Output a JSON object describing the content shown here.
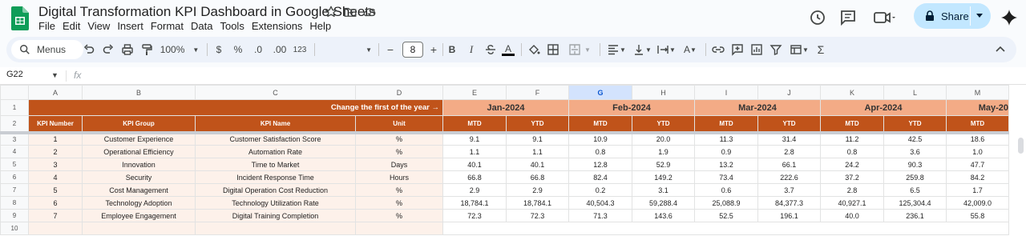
{
  "app": {
    "title": "Digital Transformation KPI Dashboard in Google Sheets",
    "menus": [
      "File",
      "Edit",
      "View",
      "Insert",
      "Format",
      "Data",
      "Tools",
      "Extensions",
      "Help"
    ],
    "share_label": "Share"
  },
  "toolbar": {
    "menus_label": "Menus",
    "zoom": "100%",
    "currency": "$",
    "percent": "%",
    "dec_decrease": ".0",
    "dec_increase": ".00",
    "format_123": "123",
    "font_size": "8",
    "bold": "B",
    "italic": "I"
  },
  "formula_bar": {
    "cell_ref": "G22",
    "fx": "fx",
    "formula": ""
  },
  "grid": {
    "col_headers": [
      "A",
      "B",
      "C",
      "D",
      "E",
      "F",
      "G",
      "H",
      "I",
      "J",
      "K",
      "L",
      "M"
    ],
    "selected_col": "G",
    "row_headers": [
      "1",
      "2",
      "3",
      "4",
      "5",
      "6",
      "7",
      "8",
      "9",
      "10"
    ],
    "row1_note": "Change the first of the year →",
    "months": [
      "Jan-2024",
      "Feb-2024",
      "Mar-2024",
      "Apr-2024",
      "May-20"
    ],
    "headers": [
      "KPI Number",
      "KPI Group",
      "KPI Name",
      "Unit"
    ],
    "mtd": "MTD",
    "ytd": "YTD",
    "rows": [
      {
        "num": "1",
        "group": "Customer Experience",
        "name": "Customer Satisfaction Score",
        "unit": "%",
        "vals": [
          "9.1",
          "9.1",
          "10.9",
          "20.0",
          "11.3",
          "31.4",
          "11.2",
          "42.5",
          "18.6"
        ]
      },
      {
        "num": "2",
        "group": "Operational Efficiency",
        "name": "Automation Rate",
        "unit": "%",
        "vals": [
          "1.1",
          "1.1",
          "0.8",
          "1.9",
          "0.9",
          "2.8",
          "0.8",
          "3.6",
          "1.0"
        ]
      },
      {
        "num": "3",
        "group": "Innovation",
        "name": "Time to Market",
        "unit": "Days",
        "vals": [
          "40.1",
          "40.1",
          "12.8",
          "52.9",
          "13.2",
          "66.1",
          "24.2",
          "90.3",
          "47.7"
        ]
      },
      {
        "num": "4",
        "group": "Security",
        "name": "Incident Response Time",
        "unit": "Hours",
        "vals": [
          "66.8",
          "66.8",
          "82.4",
          "149.2",
          "73.4",
          "222.6",
          "37.2",
          "259.8",
          "84.2"
        ]
      },
      {
        "num": "5",
        "group": "Cost Management",
        "name": "Digital Operation Cost Reduction",
        "unit": "%",
        "vals": [
          "2.9",
          "2.9",
          "0.2",
          "3.1",
          "0.6",
          "3.7",
          "2.8",
          "6.5",
          "1.7"
        ]
      },
      {
        "num": "6",
        "group": "Technology Adoption",
        "name": "Technology Utilization Rate",
        "unit": "%",
        "vals": [
          "18,784.1",
          "18,784.1",
          "40,504.3",
          "59,288.4",
          "25,088.9",
          "84,377.3",
          "40,927.1",
          "125,304.4",
          "42,009.0"
        ]
      },
      {
        "num": "7",
        "group": "Employee Engagement",
        "name": "Digital Training Completion",
        "unit": "%",
        "vals": [
          "72.3",
          "72.3",
          "71.3",
          "143.6",
          "52.5",
          "196.1",
          "40.0",
          "236.1",
          "55.8"
        ]
      }
    ]
  },
  "colors": {
    "header_dark": "#c0531a",
    "header_month": "#f3ab86",
    "kpi_fill": "#fdf1ea",
    "share_bg": "#c2e7ff"
  },
  "icons": [
    "sheets-logo",
    "star-icon",
    "move-folder-icon",
    "cloud-saved-icon",
    "history-icon",
    "comment-icon",
    "meet-icon",
    "lock-icon",
    "gemini-icon",
    "search-icon",
    "undo-icon",
    "redo-icon",
    "print-icon",
    "paint-format-icon"
  ]
}
